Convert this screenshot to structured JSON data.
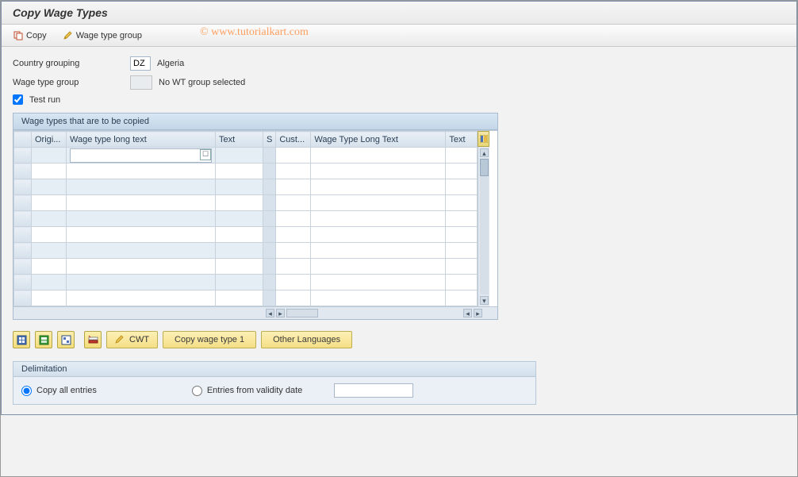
{
  "title": "Copy Wage Types",
  "toolbar": {
    "copy_label": "Copy",
    "wage_type_group_label": "Wage type group"
  },
  "watermark": "©   www.tutorialkart.com",
  "form": {
    "country_grouping_label": "Country grouping",
    "country_grouping_value": "DZ",
    "country_name": "Algeria",
    "wage_type_group_label": "Wage type group",
    "wage_type_group_value": "",
    "wage_type_group_text": "No WT group selected",
    "test_run_label": "Test run",
    "test_run_checked": true
  },
  "grid_panel": {
    "title": "Wage types that are to be copied",
    "columns": {
      "orig": "Origi...",
      "long_text_l": "Wage type long text",
      "text_l": "Text",
      "s": "S",
      "cust": "Cust...",
      "long_text_r": "Wage Type Long Text",
      "text_r": "Text"
    },
    "row_count": 10
  },
  "actions": {
    "cwt_label": "CWT",
    "copy_wt1_label": "Copy wage type 1",
    "other_lang_label": "Other Languages",
    "icon1": "select-all-icon",
    "icon2": "deselect-all-icon",
    "icon3": "selection-icon",
    "icon4": "delete-row-icon",
    "icon5": "edit-icon"
  },
  "delimitation": {
    "title": "Delimitation",
    "copy_all_label": "Copy all entries",
    "entries_from_label": "Entries from validity date",
    "selected": "copy_all",
    "date_value": ""
  }
}
